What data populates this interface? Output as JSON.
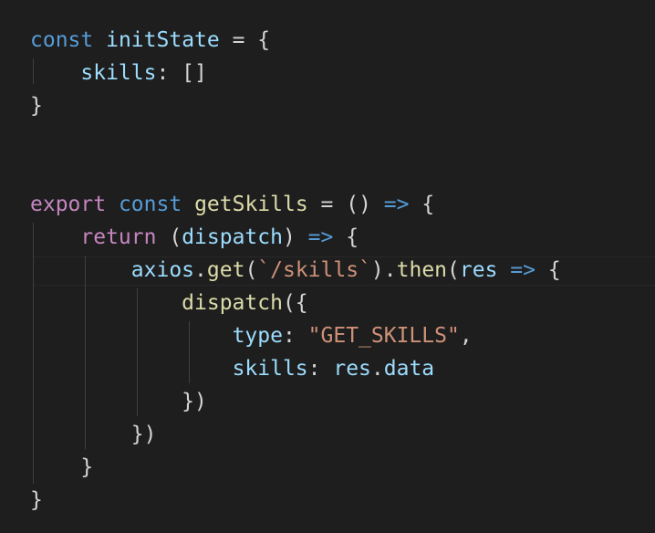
{
  "colors": {
    "background": "#1e1e1e",
    "keyword": "#569cd6",
    "control": "#c586c0",
    "variable": "#9cdcfe",
    "function": "#dcdcaa",
    "string": "#ce9178",
    "punctuation": "#d4d4d4",
    "indent_guide": "#404040"
  },
  "lines": [
    {
      "tokens": [
        {
          "text": "const",
          "role": "keyword"
        },
        {
          "text": " ",
          "role": "punctuation"
        },
        {
          "text": "initState",
          "role": "variable"
        },
        {
          "text": " = {",
          "role": "punctuation"
        }
      ]
    },
    {
      "tokens": [
        {
          "text": "    ",
          "role": "punctuation"
        },
        {
          "text": "skills",
          "role": "variable"
        },
        {
          "text": ": []",
          "role": "punctuation"
        }
      ]
    },
    {
      "tokens": [
        {
          "text": "}",
          "role": "punctuation"
        }
      ]
    },
    {
      "tokens": []
    },
    {
      "tokens": []
    },
    {
      "tokens": [
        {
          "text": "export",
          "role": "control"
        },
        {
          "text": " ",
          "role": "punctuation"
        },
        {
          "text": "const",
          "role": "keyword"
        },
        {
          "text": " ",
          "role": "punctuation"
        },
        {
          "text": "getSkills",
          "role": "function"
        },
        {
          "text": " = () ",
          "role": "punctuation"
        },
        {
          "text": "=>",
          "role": "keyword"
        },
        {
          "text": " {",
          "role": "punctuation"
        }
      ]
    },
    {
      "tokens": [
        {
          "text": "    ",
          "role": "punctuation"
        },
        {
          "text": "return",
          "role": "control"
        },
        {
          "text": " (",
          "role": "punctuation"
        },
        {
          "text": "dispatch",
          "role": "variable"
        },
        {
          "text": ") ",
          "role": "punctuation"
        },
        {
          "text": "=>",
          "role": "keyword"
        },
        {
          "text": " {",
          "role": "punctuation"
        }
      ]
    },
    {
      "tokens": [
        {
          "text": "        ",
          "role": "punctuation"
        },
        {
          "text": "axios",
          "role": "variable"
        },
        {
          "text": ".",
          "role": "punctuation"
        },
        {
          "text": "get",
          "role": "function"
        },
        {
          "text": "(",
          "role": "punctuation"
        },
        {
          "text": "`/skills`",
          "role": "string"
        },
        {
          "text": ").",
          "role": "punctuation"
        },
        {
          "text": "then",
          "role": "function"
        },
        {
          "text": "(",
          "role": "punctuation"
        },
        {
          "text": "res",
          "role": "variable"
        },
        {
          "text": " ",
          "role": "punctuation"
        },
        {
          "text": "=>",
          "role": "keyword"
        },
        {
          "text": " {",
          "role": "punctuation"
        }
      ]
    },
    {
      "tokens": [
        {
          "text": "            ",
          "role": "punctuation"
        },
        {
          "text": "dispatch",
          "role": "function"
        },
        {
          "text": "({",
          "role": "punctuation"
        }
      ]
    },
    {
      "tokens": [
        {
          "text": "                ",
          "role": "punctuation"
        },
        {
          "text": "type",
          "role": "variable"
        },
        {
          "text": ": ",
          "role": "punctuation"
        },
        {
          "text": "\"GET_SKILLS\"",
          "role": "string"
        },
        {
          "text": ",",
          "role": "punctuation"
        }
      ]
    },
    {
      "tokens": [
        {
          "text": "                ",
          "role": "punctuation"
        },
        {
          "text": "skills",
          "role": "variable"
        },
        {
          "text": ": ",
          "role": "punctuation"
        },
        {
          "text": "res",
          "role": "variable"
        },
        {
          "text": ".",
          "role": "punctuation"
        },
        {
          "text": "data",
          "role": "variable"
        }
      ]
    },
    {
      "tokens": [
        {
          "text": "            ",
          "role": "punctuation"
        },
        {
          "text": "})",
          "role": "punctuation"
        }
      ]
    },
    {
      "tokens": [
        {
          "text": "        ",
          "role": "punctuation"
        },
        {
          "text": "})",
          "role": "punctuation"
        }
      ]
    },
    {
      "tokens": [
        {
          "text": "    ",
          "role": "punctuation"
        },
        {
          "text": "}",
          "role": "punctuation"
        }
      ]
    },
    {
      "tokens": [
        {
          "text": "}",
          "role": "punctuation"
        }
      ]
    }
  ]
}
